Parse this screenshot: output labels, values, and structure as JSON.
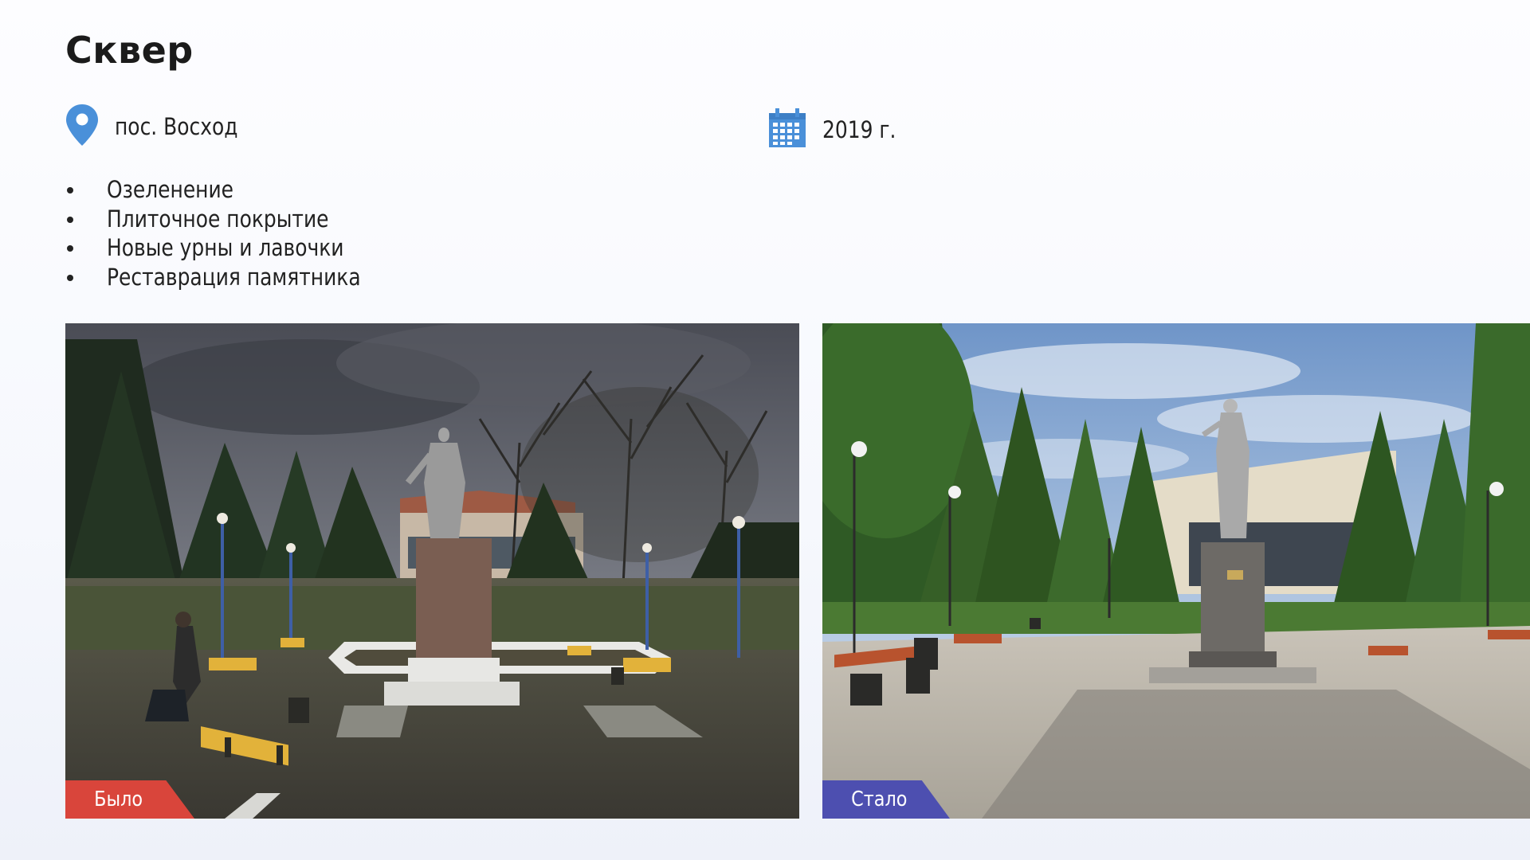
{
  "page": {
    "title": "Сквер",
    "location_icon": "map-pin-icon",
    "location": "пос. Восход",
    "calendar_icon": "calendar-icon",
    "year": "2019 г.",
    "features": [
      "Озеленение",
      "Плиточное покрытие",
      "Новые урны и лавочки",
      "Реставрация памятника"
    ]
  },
  "photos": {
    "before": {
      "label": "Было",
      "label_color": "#d9453b"
    },
    "after": {
      "label": "Стало",
      "label_color": "#4d4fb0"
    }
  },
  "colors": {
    "accent_blue": "#4a90d9",
    "text": "#222222"
  }
}
